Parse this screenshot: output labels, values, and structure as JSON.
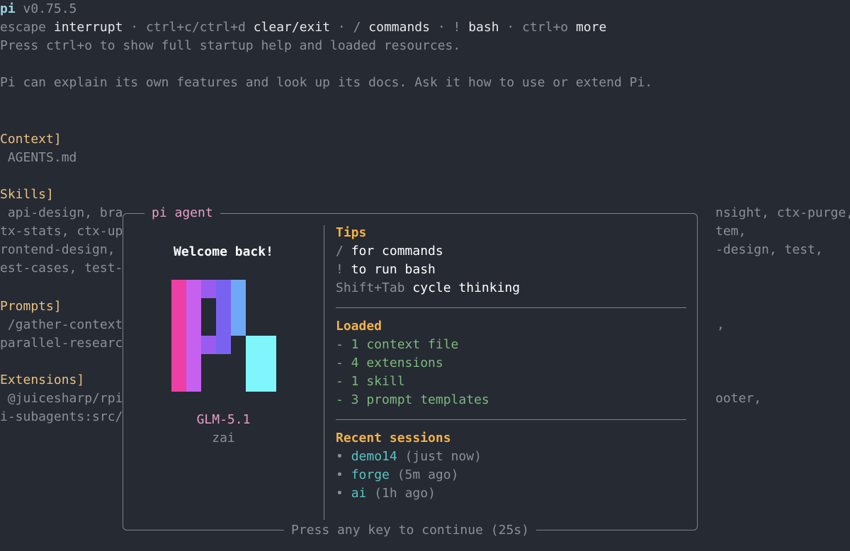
{
  "header": {
    "app_name": "pi",
    "version": "v0.75.5",
    "shortcuts": [
      {
        "key": "escape",
        "action": "interrupt"
      },
      {
        "key": "ctrl+c/ctrl+d",
        "action": "clear/exit"
      },
      {
        "key": "/",
        "action": "commands"
      },
      {
        "key": "!",
        "action": "bash"
      },
      {
        "key": "ctrl+o",
        "action": "more"
      }
    ],
    "separator": "·",
    "help_hint": "Press ctrl+o to show full startup help and loaded resources.",
    "intro": "Pi can explain its own features and look up its docs. Ask it how to use or extend Pi."
  },
  "background": {
    "context_heading": "Context]",
    "context_item": " AGENTS.md",
    "skills_heading": "Skills]",
    "skills_lines": [
      " api-design, bra",
      "tx-stats, ctx-up",
      "rontend-design, ",
      "est-cases, test-"
    ],
    "skills_right": [
      "nsight, ctx-purge,",
      "tem,",
      "-design, test,",
      ""
    ],
    "prompts_heading": "Prompts]",
    "prompts_lines": [
      " /gather-context",
      "parallel-researc"
    ],
    "prompts_right": [
      ",",
      ""
    ],
    "extensions_heading": "Extensions]",
    "extensions_lines": [
      " @juicesharp/rpi",
      "i-subagents:src/"
    ],
    "extensions_right": [
      "ooter,",
      ""
    ]
  },
  "modal": {
    "title": "pi agent",
    "welcome": "Welcome back!",
    "model": "GLM-5.1",
    "provider": "zai",
    "footer": "Press any key to continue (25s)",
    "tips": {
      "heading": "Tips",
      "items": [
        {
          "key": "/",
          "text": "for commands"
        },
        {
          "key": "!",
          "text": "to run bash"
        },
        {
          "key": "Shift+Tab",
          "text": "cycle thinking"
        }
      ]
    },
    "loaded": {
      "heading": "Loaded",
      "items": [
        "- 1 context file",
        "- 4 extensions",
        "- 1 skill",
        "- 3 prompt templates"
      ]
    },
    "recent": {
      "heading": "Recent sessions",
      "bullet": "•",
      "items": [
        {
          "name": "demo14",
          "time": "(just now)"
        },
        {
          "name": "forge",
          "time": "(5m ago)"
        },
        {
          "name": "ai",
          "time": "(1h ago)"
        }
      ]
    }
  },
  "colors": {
    "background": "#262a33",
    "heading_gold": "#f1b24a",
    "section_yellow": "#e8c07d",
    "accent_pink": "#e79fc6",
    "loaded_green": "#7cb87c",
    "session_cyan": "#58c4c4",
    "logo": [
      "#ee3fa4",
      "#c660ef",
      "#9a5cf0",
      "#7a62f0",
      "#6fa9f6",
      "#7ff6fb"
    ]
  }
}
